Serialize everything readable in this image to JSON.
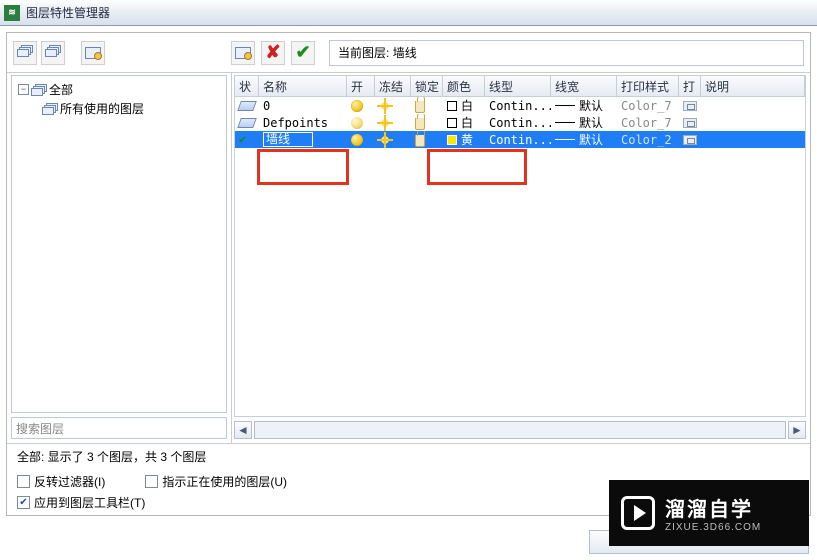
{
  "window": {
    "title": "图层特性管理器"
  },
  "currentLayer": {
    "label_prefix": "当前图层:",
    "name": "墙线"
  },
  "tree": {
    "root": "全部",
    "child": "所有使用的图层"
  },
  "searchPlaceholder": "搜索图层",
  "columns": {
    "status": "状",
    "name": "名称",
    "on": "开",
    "freeze": "冻结",
    "lock": "锁定",
    "color": "颜色",
    "ltype": "线型",
    "lw": "线宽",
    "pstyle": "打印样式",
    "plot": "打",
    "desc": "说明"
  },
  "colors": {
    "white": "白",
    "yellow": "黄",
    "pstyle7": "Color_7",
    "pstyle2": "Color_2"
  },
  "rows": [
    {
      "name": "0",
      "colorName": "white",
      "ltype": "Contin...",
      "lw": "默认",
      "pstyle": "pstyle7",
      "selected": false,
      "current": false
    },
    {
      "name": "Defpoints",
      "colorName": "white",
      "ltype": "Contin...",
      "lw": "默认",
      "pstyle": "pstyle7",
      "selected": false,
      "current": false
    },
    {
      "name": "墙线",
      "colorName": "yellow",
      "ltype": "Contin...",
      "lw": "默认",
      "pstyle": "pstyle2",
      "selected": true,
      "current": true
    }
  ],
  "statusLine": "全部: 显示了 3 个图层，共 3 个图层",
  "checks": {
    "invert": "反转过滤器(I)",
    "inuse": "指示正在使用的图层(U)",
    "applyToolbar": "应用到图层工具栏(T)"
  },
  "watermark": {
    "brand": "溜溜自学",
    "url": "ZIXUE.3D66.COM"
  },
  "icons": {
    "delete": "✘",
    "setcurrent": "✔",
    "treeCollapse": "−",
    "checked": "✔",
    "left": "◄",
    "right": "►"
  }
}
